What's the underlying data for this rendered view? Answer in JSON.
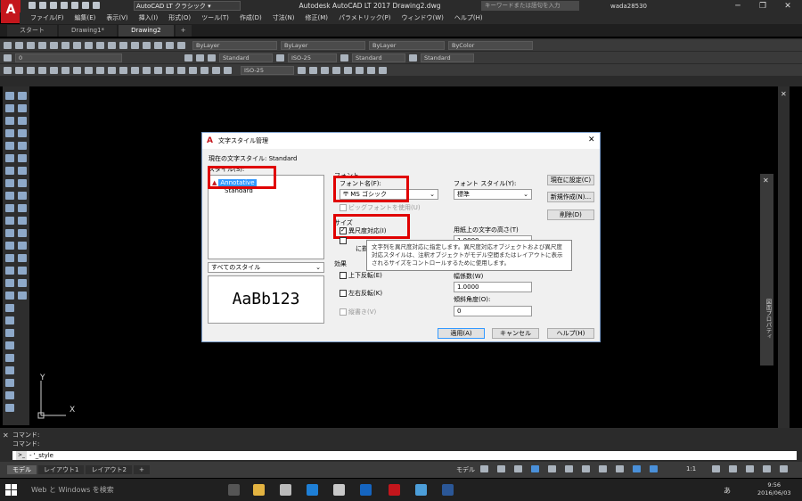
{
  "titlebar": {
    "app_logo": "A",
    "workspace": "AutoCAD LT クラシック",
    "title": "Autodesk AutoCAD LT 2017   Drawing2.dwg",
    "search_placeholder": "キーワードまたは語句を入力",
    "user": "wada28530",
    "minimize": "─",
    "maximize": "❐",
    "close": "✕"
  },
  "menu": [
    "ファイル(F)",
    "編集(E)",
    "表示(V)",
    "挿入(I)",
    "形式(O)",
    "ツール(T)",
    "作成(D)",
    "寸法(N)",
    "修正(M)",
    "パラメトリック(P)",
    "ウィンドウ(W)",
    "ヘルプ(H)"
  ],
  "tabs": [
    "スタート",
    "Drawing1*",
    "Drawing2"
  ],
  "tab_add": "+",
  "toolbar": {
    "layer_combo": "ByLayer",
    "linetype_combo": "ByLayer",
    "lineweight_combo": "ByLayer",
    "color_combo": "ByColor",
    "layer_name": "0",
    "textstyle_combo": "Standard",
    "dimstyle_combo": "ISO-25",
    "tablestyle_combo": "Standard",
    "mleaderstyle_combo": "Standard",
    "dim_combo2": "ISO-25"
  },
  "dialog": {
    "title": "文字スタイル管理",
    "close": "✕",
    "current_style_label": "現在の文字スタイル: Standard",
    "styles_label": "スタイル(S):",
    "styles": [
      "Annotative",
      "Standard"
    ],
    "filter_value": "すべてのスタイル",
    "preview_text": "AaBb123",
    "font_group": "フォント",
    "font_name_label": "フォント名(F):",
    "font_name_value": "MS ゴシック",
    "font_style_label": "フォント スタイル(Y):",
    "font_style_value": "標準",
    "bigfont_label": "ビッグフォントを使用(U)",
    "size_group": "サイズ",
    "annotative_label": "異尺度対応(I)",
    "annotative_checked": true,
    "match_orientation_label": "に揃",
    "paper_height_label": "用紙上の文字の高さ(T)",
    "paper_height_value": "1.0000",
    "effects_group": "効果",
    "upside_down_label": "上下反転(E)",
    "backwards_label": "左右反転(K)",
    "vertical_label": "縦書き(V)",
    "width_factor_label": "幅係数(W)",
    "width_factor_value": "1.0000",
    "oblique_label": "傾斜角度(O):",
    "oblique_value": "0",
    "set_current_btn": "現在に設定(C)",
    "new_btn": "新規作成(N)...",
    "delete_btn": "削除(D)",
    "apply_btn": "適用(A)",
    "cancel_btn": "キャンセル",
    "help_btn": "ヘルプ(H)",
    "tooltip": "文字列を異尺度対応に指定します。異尺度対応オブジェクトおよび異尺度対応スタイルは、注釈オブジェクトがモデル空間またはレイアウトに表示されるサイズをコントロールするために使用します。"
  },
  "canvas": {
    "ucs_y": "Y",
    "ucs_x": "X"
  },
  "command": {
    "history": [
      "コマンド:",
      "コマンド:"
    ],
    "input": "- '_style",
    "prompt_icon": ">_"
  },
  "layout_tabs": [
    "モデル",
    "レイアウト1",
    "レイアウト2"
  ],
  "layout_add": "+",
  "status": {
    "model": "モデル",
    "scale": "1:1"
  },
  "right_palette": {
    "label": "図面プロパティ"
  },
  "taskbar": {
    "search": "Web と Windows を検索",
    "time": "9:56",
    "date": "2016/06/03",
    "ime": "あ"
  }
}
